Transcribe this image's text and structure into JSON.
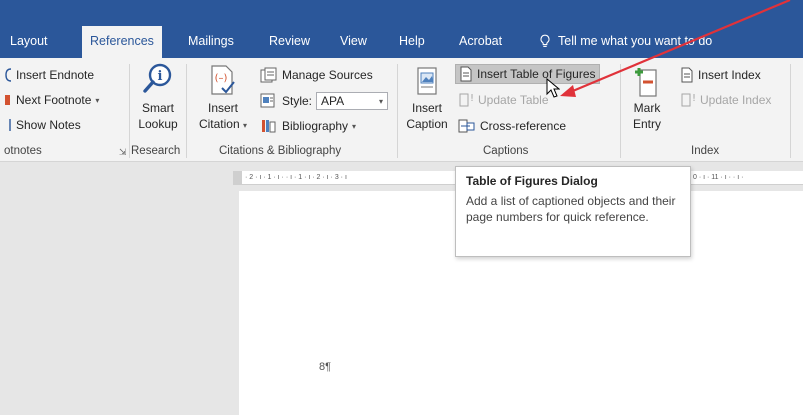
{
  "tabs": [
    {
      "label": "Layout"
    },
    {
      "label": "References"
    },
    {
      "label": "Mailings"
    },
    {
      "label": "Review"
    },
    {
      "label": "View"
    },
    {
      "label": "Help"
    },
    {
      "label": "Acrobat"
    }
  ],
  "tell_me": "Tell me what you want to do",
  "footnotes": {
    "insert_endnote": "Insert Endnote",
    "next_footnote": "Next Footnote",
    "show_notes": "Show Notes",
    "group_label": "otnotes"
  },
  "research": {
    "smart_lookup_line1": "Smart",
    "smart_lookup_line2": "Lookup",
    "group_label": "Research"
  },
  "citations": {
    "insert_citation_line1": "Insert",
    "insert_citation_line2": "Citation",
    "manage_sources": "Manage Sources",
    "style_label": "Style:",
    "style_value": "APA",
    "bibliography": "Bibliography",
    "group_label": "Citations & Bibliography"
  },
  "captions": {
    "insert_caption_line1": "Insert",
    "insert_caption_line2": "Caption",
    "insert_table_of_figures": "Insert Table of Figures",
    "update_table": "Update Table",
    "cross_reference": "Cross-reference",
    "group_label": "Captions"
  },
  "index": {
    "mark_entry_line1": "Mark",
    "mark_entry_line2": "Entry",
    "insert_index": "Insert Index",
    "update_index": "Update Index",
    "group_label": "Index"
  },
  "ruler_text": "· 2 · ı · 1 · ı ·    · ı · 1 · ı · 2 · ı · 3 · ı",
  "ruler_text_right": "0 · ı · 11 · ı ·    · ı ·",
  "tooltip": {
    "title": "Table of Figures Dialog",
    "body": "Add a list of captioned objects and their page numbers for quick reference."
  },
  "document": {
    "paragraph_mark": "8¶"
  },
  "colors": {
    "ribbon_blue": "#2b579a",
    "arrow_red": "#e0323a"
  }
}
